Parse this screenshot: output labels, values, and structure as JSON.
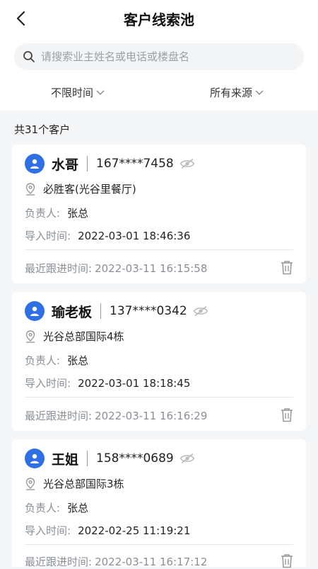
{
  "header": {
    "title": "客户线索池",
    "back_icon": "chevron-left-icon"
  },
  "search": {
    "placeholder": "请搜索业主姓名或电话或楼盘名",
    "value": ""
  },
  "filters": {
    "time_label": "不限时间",
    "source_label": "所有来源"
  },
  "summary": {
    "count_text": "共31个客户"
  },
  "labels": {
    "owner": "负责人:",
    "import_time": "导入时间:",
    "last_follow": "最近跟进时间:"
  },
  "customers": [
    {
      "name": "水哥",
      "phone": "167****7458",
      "location": "必胜客(光谷里餐厅)",
      "owner": "张总",
      "import_time": "2022-03-01 18:46:36",
      "last_follow": "2022-03-11 16:15:58"
    },
    {
      "name": "瑜老板",
      "phone": "137****0342",
      "location": "光谷总部国际4栋",
      "owner": "张总",
      "import_time": "2022-03-01 18:18:45",
      "last_follow": "2022-03-11 16:16:29"
    },
    {
      "name": "王姐",
      "phone": "158****0689",
      "location": "光谷总部国际3栋",
      "owner": "张总",
      "import_time": "2022-02-25 11:19:21",
      "last_follow": "2022-03-11 16:17:12"
    }
  ],
  "colors": {
    "accent": "#2f6fe4",
    "muted_text": "#8a8f96",
    "page_bg": "#f4f5f7"
  }
}
